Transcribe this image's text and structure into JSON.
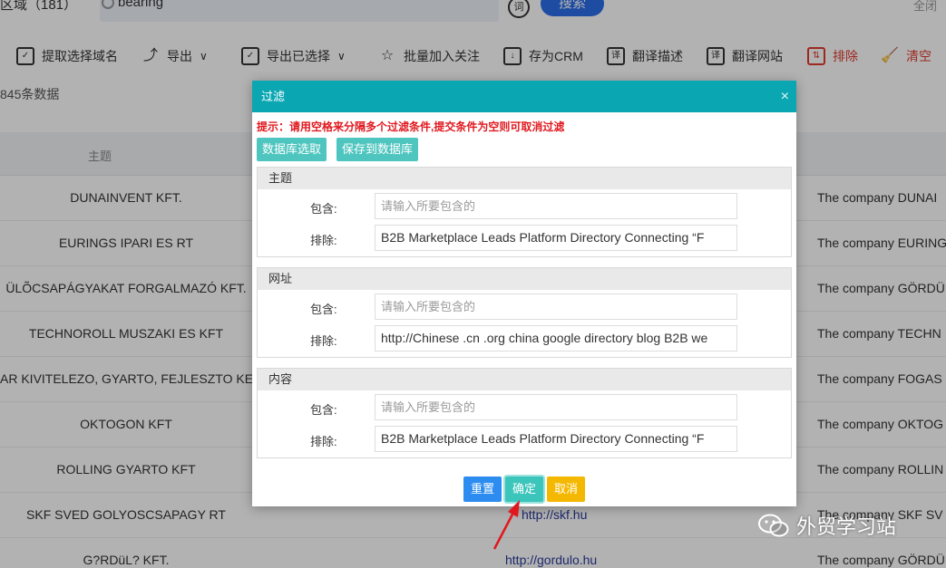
{
  "topbar": {
    "region_label": "区域（181）",
    "search_value": "bearing",
    "ci_label": "词",
    "search_button": "搜索",
    "close_all": "全闭"
  },
  "toolbar": {
    "items": [
      {
        "label": "提取选择域名",
        "icon": "check-square-icon"
      },
      {
        "label": "导出",
        "icon": "export-icon"
      },
      {
        "label": "导出已选择",
        "icon": "check-square-icon"
      },
      {
        "label": "批量加入关注",
        "icon": "star-icon"
      },
      {
        "label": "存为CRM",
        "icon": "save-download-icon"
      },
      {
        "label": "翻译描述",
        "icon": "translate-icon"
      },
      {
        "label": "翻译网站",
        "icon": "translate-icon"
      },
      {
        "label": "排除",
        "icon": "exclude-icon"
      },
      {
        "label": "清空",
        "icon": "broom-icon"
      }
    ]
  },
  "count_text": "845条数据",
  "table": {
    "header_subject": "主题",
    "rows": [
      {
        "subject": "DUNAINVENT KFT.",
        "url": "",
        "desc": "The company DUNAI"
      },
      {
        "subject": "EURINGS IPARI ES RT",
        "url": "",
        "desc": "The company EURING"
      },
      {
        "subject": "ÜLÕCSAPÁGYAKAT FORGALMAZÓ KFT.",
        "url": "",
        "desc": "The company GÖRDÜ"
      },
      {
        "subject": "TECHNOROLL MUSZAKI ES KFT",
        "url": "",
        "desc": "The company TECHN"
      },
      {
        "subject": "AR KIVITELEZO, GYARTO, FEJLESZTO KERE",
        "url": "",
        "desc": "The company FOGAS"
      },
      {
        "subject": "OKTOGON KFT",
        "url": "",
        "desc": "The company OKTOG"
      },
      {
        "subject": "ROLLING GYARTO KFT",
        "url": "",
        "desc": "The company ROLLIN"
      },
      {
        "subject": "SKF SVED GOLYOSCSAPAGY RT",
        "url": "http://skf.hu",
        "desc": "The company SKF SV"
      },
      {
        "subject": "G?RDüL? KFT.",
        "url": "http://gordulo.hu",
        "desc": "The company GÖRDÜ"
      }
    ]
  },
  "dialog": {
    "title": "过滤",
    "hint": "提示：请用空格来分隔多个过滤条件,提交条件为空则可取消过滤",
    "db_select": "数据库选取",
    "save_db": "保存到数据库",
    "sections": [
      {
        "title": "主题",
        "include_label": "包含:",
        "include_placeholder": "请输入所要包含的",
        "include_value": "",
        "exclude_label": "排除:",
        "exclude_value": "B2B Marketplace Leads Platform Directory Connecting   “F"
      },
      {
        "title": "网址",
        "include_label": "包含:",
        "include_placeholder": "请输入所要包含的",
        "include_value": "",
        "exclude_label": "排除:",
        "exclude_value": "http://Chinese .cn .org china google directory blog B2B we"
      },
      {
        "title": "内容",
        "include_label": "包含:",
        "include_placeholder": "请输入所要包含的",
        "include_value": "",
        "exclude_label": "排除:",
        "exclude_value": "B2B Marketplace Leads Platform Directory Connecting   “F"
      }
    ],
    "reset": "重置",
    "confirm": "确定",
    "cancel": "取消"
  },
  "watermark": "外贸学习站",
  "colors": {
    "header_teal": "#0aa7b3",
    "btn_teal": "#4fc5bf",
    "reset_blue": "#2d8cf0",
    "confirm_teal": "#3cc5bb",
    "cancel_yellow": "#f5b800",
    "hint_red": "#e0181e",
    "arrow_red": "#e0181e"
  }
}
